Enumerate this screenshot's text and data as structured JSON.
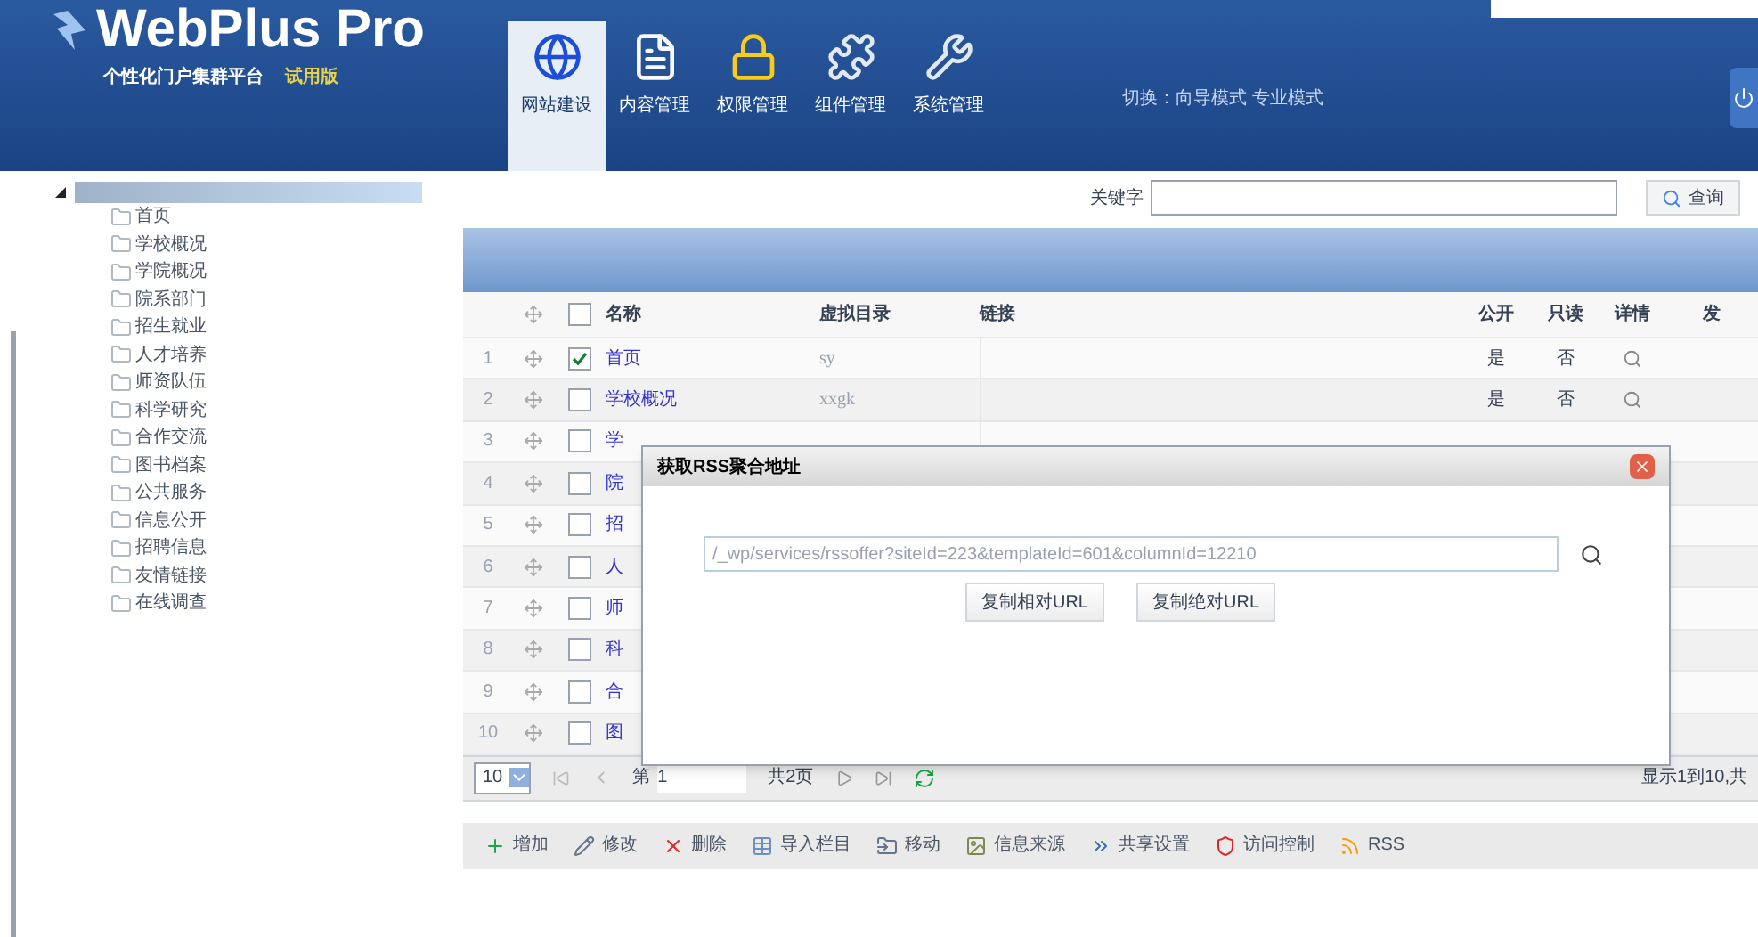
{
  "header": {
    "logo": "WebPlus Pro",
    "subtitle": "个性化门户集群平台",
    "badge": "试用版",
    "tabs": [
      {
        "label": "网站建设",
        "kind": "globe",
        "selected": true
      },
      {
        "label": "内容管理",
        "kind": "document",
        "selected": false
      },
      {
        "label": "权限管理",
        "kind": "lock",
        "selected": false
      },
      {
        "label": "组件管理",
        "kind": "puzzle",
        "selected": false
      },
      {
        "label": "系统管理",
        "kind": "tools",
        "selected": false
      }
    ],
    "mode_switch": "切换：向导模式 专业模式"
  },
  "sidebar": {
    "root": {
      "expanded": true,
      "children": [
        {
          "label": "首页"
        },
        {
          "label": "学校概况"
        },
        {
          "label": "学院概况"
        },
        {
          "label": "院系部门"
        },
        {
          "label": "招生就业"
        },
        {
          "label": "人才培养"
        },
        {
          "label": "师资队伍"
        },
        {
          "label": "科学研究"
        },
        {
          "label": "合作交流"
        },
        {
          "label": "图书档案"
        },
        {
          "label": "公共服务"
        },
        {
          "label": "信息公开"
        },
        {
          "label": "招聘信息"
        },
        {
          "label": "友情链接"
        },
        {
          "label": "在线调查"
        }
      ]
    }
  },
  "search": {
    "label": "关键字",
    "button": "查询"
  },
  "table": {
    "columns": [
      "名称",
      "虚拟目录",
      "链接",
      "公开",
      "只读",
      "详情",
      "发"
    ],
    "all_checked": false,
    "rows": [
      {
        "index": "1",
        "checked": true,
        "name": "首页",
        "directory": "sy",
        "public": "是",
        "readonly": "否"
      },
      {
        "index": "2",
        "checked": false,
        "name": "学校概况",
        "directory": "xxgk",
        "public": "是",
        "readonly": "否"
      },
      {
        "index": "3",
        "checked": false,
        "name": "学"
      },
      {
        "index": "4",
        "checked": false,
        "name": "院"
      },
      {
        "index": "5",
        "checked": false,
        "name": "招"
      },
      {
        "index": "6",
        "checked": false,
        "name": "人"
      },
      {
        "index": "7",
        "checked": false,
        "name": "师"
      },
      {
        "index": "8",
        "checked": false,
        "name": "科"
      },
      {
        "index": "9",
        "checked": false,
        "name": "合"
      },
      {
        "index": "10",
        "checked": false,
        "name": "图"
      }
    ]
  },
  "pagination": {
    "page_size": "10",
    "page_label": "第",
    "page": "1",
    "total": "共2页",
    "summary": "显示1到10,共"
  },
  "toolbar": [
    {
      "label": "增加",
      "kind": "add"
    },
    {
      "label": "修改",
      "kind": "edit"
    },
    {
      "label": "删除",
      "kind": "delete"
    },
    {
      "label": "导入栏目",
      "kind": "import"
    },
    {
      "label": "移动",
      "kind": "move"
    },
    {
      "label": "信息来源",
      "kind": "source"
    },
    {
      "label": "共享设置",
      "kind": "share"
    },
    {
      "label": "访问控制",
      "kind": "access"
    },
    {
      "label": "RSS",
      "kind": "rss"
    }
  ],
  "dialog": {
    "title": "获取RSS聚合地址",
    "url": "/_wp/services/rssoffer?siteId=223&templateId=601&columnId=12210",
    "buttons": [
      "复制相对URL",
      "复制绝对URL"
    ]
  }
}
